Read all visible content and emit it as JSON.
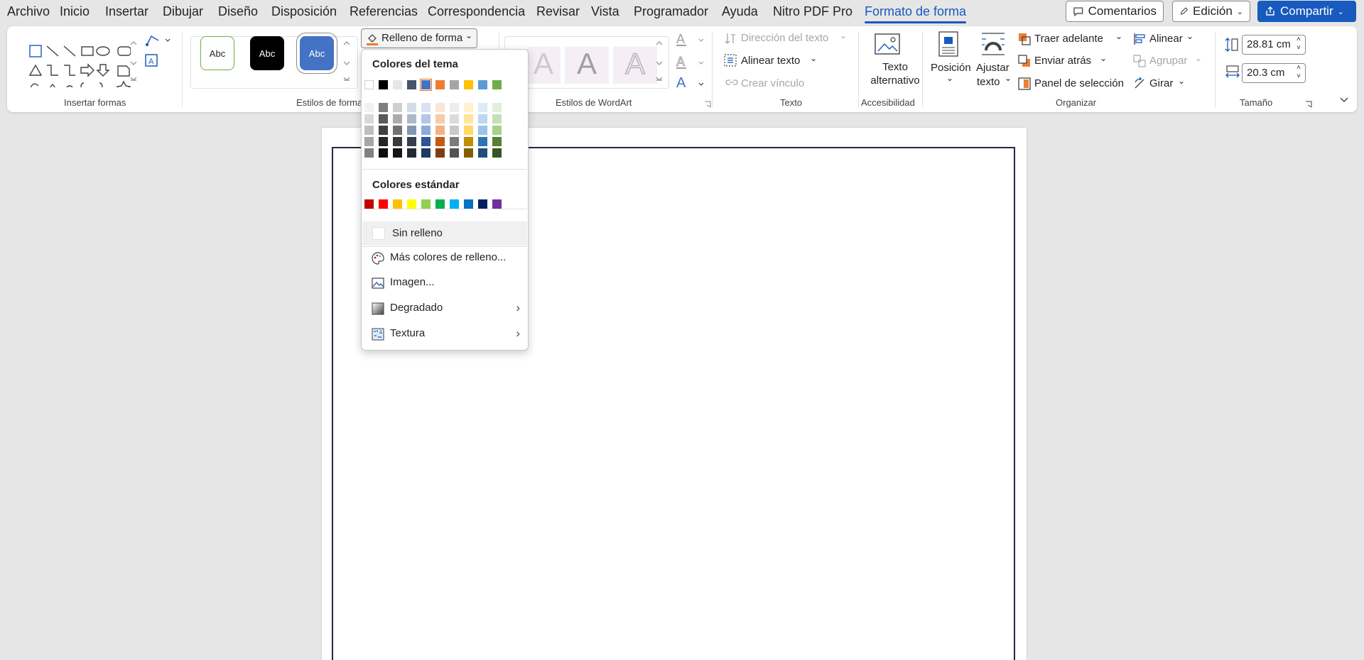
{
  "menu": {
    "tabs": [
      "Archivo",
      "Inicio",
      "Insertar",
      "Dibujar",
      "Diseño",
      "Disposición",
      "Referencias",
      "Correspondencia",
      "Revisar",
      "Vista",
      "Programador",
      "Ayuda",
      "Nitro PDF Pro",
      "Formato de forma"
    ],
    "active_tab": "Formato de forma",
    "comments_label": "Comentarios",
    "editing_label": "Edición",
    "share_label": "Compartir"
  },
  "ribbon": {
    "insert_shapes_label": "Insertar formas",
    "shape_styles_label": "Estilos de forma",
    "style_samples": [
      "Abc",
      "Abc",
      "Abc"
    ],
    "shape_fill_label": "Relleno de forma",
    "wordart_label": "Estilos de WordArt",
    "text_group": {
      "label": "Texto",
      "text_direction": "Dirección del texto",
      "align_text": "Alinear texto",
      "create_link": "Crear vínculo"
    },
    "accessibility": {
      "label": "Accesibilidad",
      "alt_text_line1": "Texto",
      "alt_text_line2": "alternativo"
    },
    "arrange": {
      "label": "Organizar",
      "position": "Posición",
      "wrap_line1": "Ajustar",
      "wrap_line2": "texto",
      "bring_forward": "Traer adelante",
      "send_backward": "Enviar atrás",
      "selection_pane": "Panel de selección",
      "align": "Alinear",
      "group": "Agrupar",
      "rotate": "Girar"
    },
    "size": {
      "label": "Tamaño",
      "height": "28.81 cm",
      "width": "20.3 cm"
    }
  },
  "dropdown": {
    "theme_colors_label": "Colores del tema",
    "standard_colors_label": "Colores estándar",
    "theme_top": [
      "#ffffff",
      "#000000",
      "#e7e6e6",
      "#44546a",
      "#4472c4",
      "#ed7d31",
      "#a5a5a5",
      "#ffc000",
      "#5b9bd5",
      "#70ad47"
    ],
    "theme_shades": [
      [
        "#f2f2f2",
        "#d9d9d9",
        "#bfbfbf",
        "#a6a6a6",
        "#808080"
      ],
      [
        "#7f7f7f",
        "#595959",
        "#404040",
        "#262626",
        "#0d0d0d"
      ],
      [
        "#d0cece",
        "#aeabab",
        "#757070",
        "#3a3838",
        "#171616"
      ],
      [
        "#d6dce4",
        "#adb9ca",
        "#8497b0",
        "#333f4f",
        "#222a35"
      ],
      [
        "#d9e2f3",
        "#b4c6e7",
        "#8eaadb",
        "#2f5496",
        "#1f3864"
      ],
      [
        "#fbe5d5",
        "#f7caac",
        "#f4b183",
        "#c55a11",
        "#833c0b"
      ],
      [
        "#ededed",
        "#dbdbdb",
        "#c9c9c9",
        "#7b7b7b",
        "#525252"
      ],
      [
        "#fff2cc",
        "#ffe599",
        "#ffd966",
        "#bf8f00",
        "#7f6000"
      ],
      [
        "#deebf6",
        "#bdd7ee",
        "#9cc3e5",
        "#2e75b5",
        "#1e4e79"
      ],
      [
        "#e2efd9",
        "#c5e0b3",
        "#a8d08d",
        "#538135",
        "#375623"
      ]
    ],
    "standard": [
      "#c00000",
      "#ff0000",
      "#ffc000",
      "#ffff00",
      "#92d050",
      "#00b050",
      "#00b0f0",
      "#0070c0",
      "#002060",
      "#7030a0"
    ],
    "no_fill": "Sin relleno",
    "more_colors": "Más colores de relleno...",
    "picture": "Imagen...",
    "gradient": "Degradado",
    "texture": "Textura"
  }
}
